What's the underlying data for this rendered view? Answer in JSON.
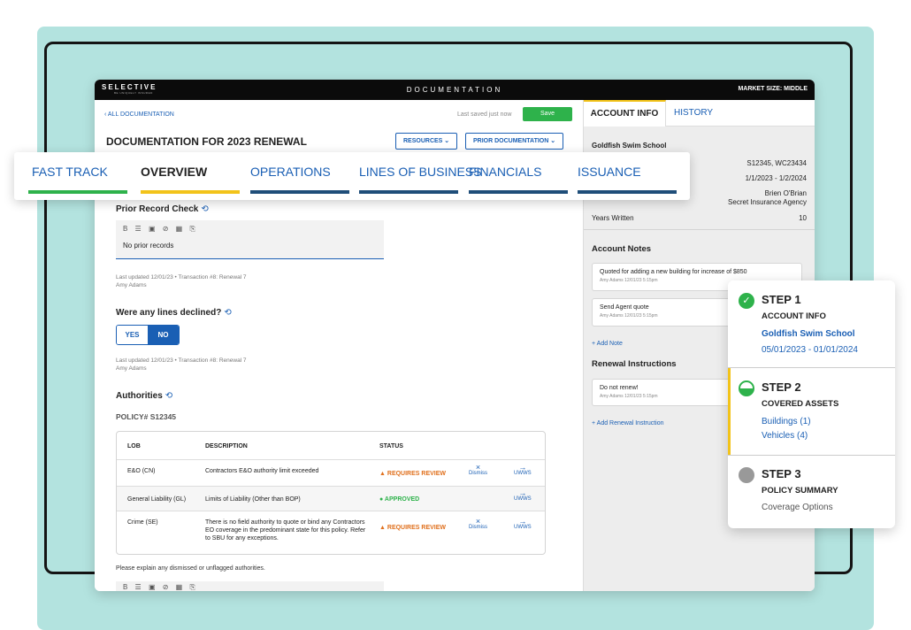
{
  "app": {
    "brand": "SELECTIVE",
    "brand_sub": "BE UNIQUELY INSURED",
    "title": "DOCUMENTATION",
    "market_size": "MARKET SIZE: MIDDLE"
  },
  "header": {
    "back_link": "ALL DOCUMENTATION",
    "saved_status": "Last saved just now",
    "save_label": "Save",
    "doc_title": "DOCUMENTATION FOR 2023 RENEWAL",
    "resources_label": "RESOURCES",
    "prior_doc_label": "PRIOR DOCUMENTATION"
  },
  "tabs": [
    {
      "label": "FAST TRACK",
      "color": "#2eb24b"
    },
    {
      "label": "OVERVIEW",
      "color": "#f2c31a"
    },
    {
      "label": "OPERATIONS",
      "color": "#1f4e79"
    },
    {
      "label": "LINES OF BUSINESS",
      "color": "#1f4e79"
    },
    {
      "label": "FINANCIALS",
      "color": "#1f4e79"
    },
    {
      "label": "ISSUANCE",
      "color": "#1f4e79"
    }
  ],
  "prior_record": {
    "heading": "Prior Record Check",
    "toolbar": "B ☰ ▣ ⊘ ▦ ⎘",
    "text": "No prior records",
    "meta_line1": "Last updated 12/01/23 • Transaction #8: Renewal 7",
    "meta_line2": "Amy Adams"
  },
  "declined": {
    "heading": "Were any lines declined?",
    "yes": "YES",
    "no": "NO",
    "meta_line1": "Last updated 12/01/23 • Transaction #8: Renewal 7",
    "meta_line2": "Amy Adams"
  },
  "authorities": {
    "heading": "Authorities",
    "policy": "POLICY# S12345",
    "columns": [
      "LOB",
      "DESCRIPTION",
      "STATUS"
    ],
    "rows": [
      {
        "lob": "E&O (CN)",
        "description": "Contractors E&O authority limit exceeded",
        "status": "REQUIRES REVIEW",
        "dismiss": "Dismiss",
        "uwws": "UWWS"
      },
      {
        "lob": "General Liability (GL)",
        "description": "Limits of Liability (Other than BOP)",
        "status": "APPROVED",
        "uwws": "UWWS"
      },
      {
        "lob": "Crime (SE)",
        "description": "There is no field authority to quote or bind any Contractors EO coverage in the predominant state for this policy. Refer to SBU for any exceptions.",
        "status": "REQUIRES REVIEW",
        "dismiss": "Dismiss",
        "uwws": "UWWS"
      }
    ],
    "explain": "Please explain any dismissed or unflagged authorities."
  },
  "account_info": {
    "tab_active": "ACCOUNT INFO",
    "tab_history": "HISTORY",
    "name": "Goldfish Swim School",
    "policy_numbers": "S12345, WC23434",
    "term": "1/1/2023 - 1/2/2024",
    "agent": "Brien O'Brian",
    "agency": "Secret Insurance Agency",
    "years_label": "Years Written",
    "years_value": "10"
  },
  "account_notes": {
    "heading": "Account Notes",
    "notes": [
      {
        "text": "Quoted for adding a new building for increase of $850",
        "meta": "Amy Adams 12/01/23 5:15pm"
      },
      {
        "text": "Send Agent quote",
        "meta": "Amy Adams 12/01/23 5:15pm"
      }
    ],
    "add_note": "+ Add Note"
  },
  "renewal": {
    "heading": "Renewal Instructions",
    "text": "Do not renew!",
    "meta": "Amy Adams 12/01/23 5:15pm",
    "add_label": "+ Add Renewal Instruction"
  },
  "steps": [
    {
      "title": "STEP 1",
      "sub": "ACCOUNT INFO",
      "line1": "Goldfish Swim School",
      "line2": "05/01/2023 - 01/01/2024",
      "status": "complete"
    },
    {
      "title": "STEP 2",
      "sub": "COVERED ASSETS",
      "line1": "Buildings (1)",
      "line2": "Vehicles (4)",
      "status": "in-progress"
    },
    {
      "title": "STEP 3",
      "sub": "POLICY SUMMARY",
      "line1": "Coverage Options",
      "status": "not-started"
    }
  ]
}
